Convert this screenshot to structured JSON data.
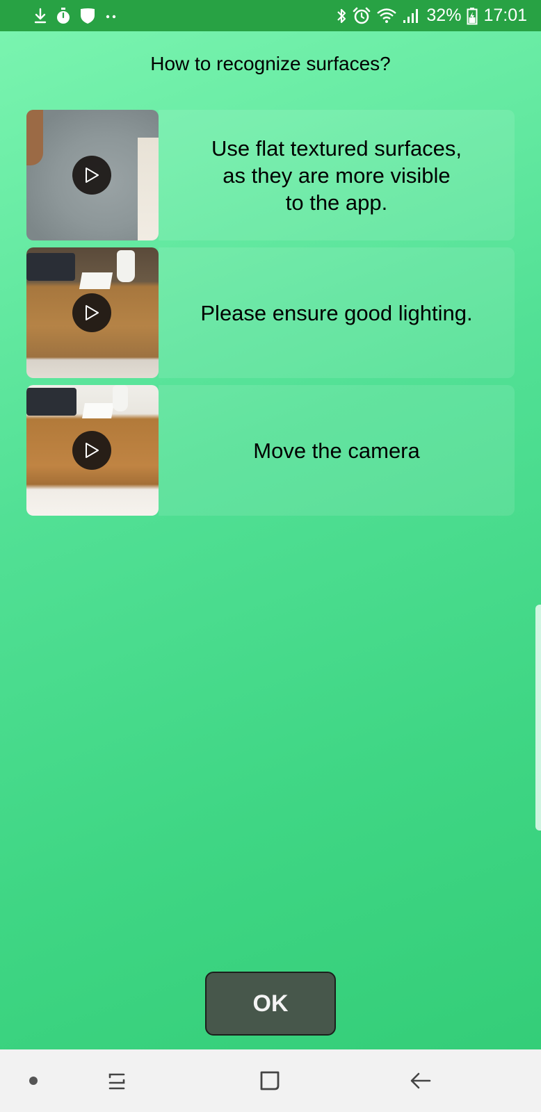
{
  "status_bar": {
    "battery": "32%",
    "time": "17:01",
    "icons_left": [
      "download-icon",
      "stopwatch-icon",
      "shield-icon",
      "more-dots-icon"
    ],
    "icons_right": [
      "bluetooth-icon",
      "alarm-icon",
      "wifi-icon",
      "signal-icon",
      "battery-icon"
    ]
  },
  "page": {
    "title": "How to recognize surfaces?"
  },
  "tips": [
    {
      "text": "Use flat textured surfaces,\nas they are more visible\nto the app.",
      "media": "play-icon"
    },
    {
      "text": "Please ensure good lighting.",
      "media": "play-icon"
    },
    {
      "text": "Move the camera",
      "media": "play-icon"
    }
  ],
  "actions": {
    "ok_label": "OK"
  },
  "nav_bar": {
    "items": [
      "dot-icon",
      "recent-apps-icon",
      "home-icon",
      "back-icon"
    ]
  },
  "colors": {
    "status_bar": "#28a244",
    "background_top": "#7cf5b1",
    "background_bottom": "#32cc76",
    "ok_button": "#47574b",
    "nav_bar": "#f2f2f2"
  }
}
